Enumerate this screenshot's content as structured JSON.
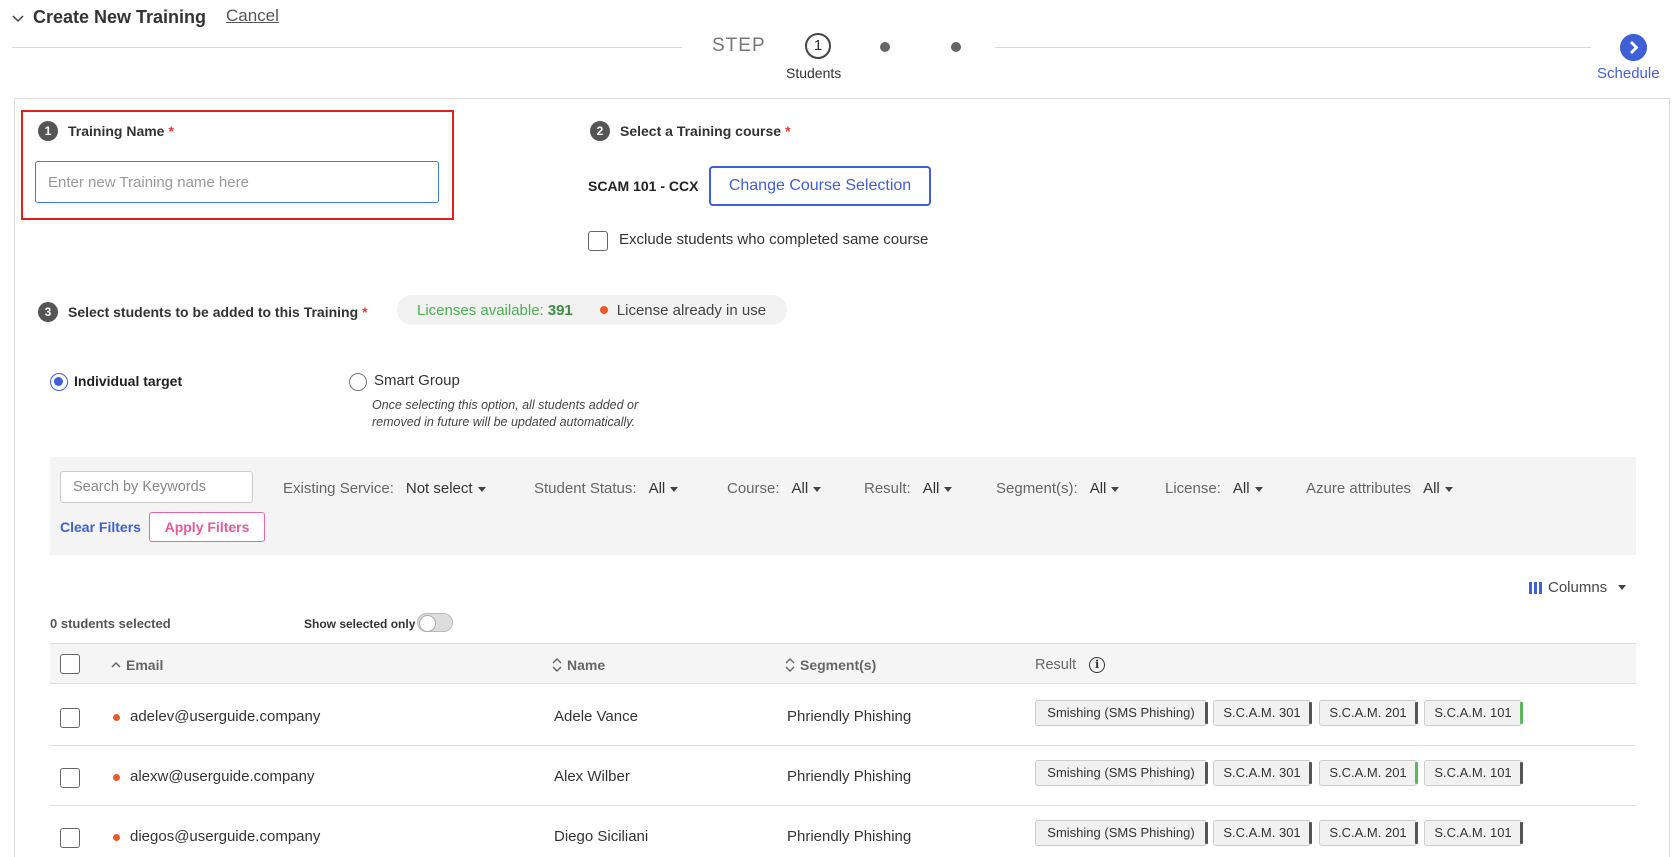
{
  "header": {
    "title": "Create New Training",
    "cancel_label": "Cancel",
    "step_label": "STEP",
    "step_number": "1",
    "step_name": "Students",
    "final_step_name": "Schedule"
  },
  "section1": {
    "number": "1",
    "title": "Training Name",
    "required_mark": "*",
    "input_placeholder": "Enter new Training name here",
    "input_value": ""
  },
  "section2": {
    "number": "2",
    "title": "Select a Training course",
    "required_mark": "*",
    "course_code": "SCAM 101 - CCX",
    "change_button": "Change Course Selection",
    "exclude_label": "Exclude students who completed same course"
  },
  "section3": {
    "number": "3",
    "title": "Select students to be added to this Training",
    "required_mark": "*",
    "licenses_label": "Licenses available:",
    "licenses_count": "391",
    "license_in_use": "License already in use"
  },
  "targeting": {
    "individual_label": "Individual target",
    "smart_label": "Smart Group",
    "smart_desc": "Once selecting this option, all students added or removed in future will be updated automatically.",
    "selected": "individual"
  },
  "filters": {
    "search_placeholder": "Search by Keywords",
    "items": [
      {
        "label": "Existing Service:",
        "value": "Not select"
      },
      {
        "label": "Student Status:",
        "value": "All"
      },
      {
        "label": "Course:",
        "value": "All"
      },
      {
        "label": "Result:",
        "value": "All"
      },
      {
        "label": "Segment(s):",
        "value": "All"
      },
      {
        "label": "License:",
        "value": "All"
      },
      {
        "label": "Azure attributes",
        "value": "All"
      }
    ],
    "clear_label": "Clear Filters",
    "apply_label": "Apply Filters"
  },
  "table": {
    "columns_button": "Columns",
    "selected_count": "0 students selected",
    "show_selected_only": "Show selected only",
    "headers": {
      "email": "Email",
      "name": "Name",
      "segments": "Segment(s)",
      "result": "Result"
    },
    "rows": [
      {
        "email": "adelev@userguide.company",
        "name": "Adele Vance",
        "segment": "Phriendly Phishing",
        "tags": [
          "Smishing (SMS Phishing)",
          "S.C.A.M. 301",
          "S.C.A.M. 201",
          "S.C.A.M. 101"
        ],
        "green_tag": 3
      },
      {
        "email": "alexw@userguide.company",
        "name": "Alex Wilber",
        "segment": "Phriendly Phishing",
        "tags": [
          "Smishing (SMS Phishing)",
          "S.C.A.M. 301",
          "S.C.A.M. 201",
          "S.C.A.M. 101"
        ],
        "green_tag": 2
      },
      {
        "email": "diegos@userguide.company",
        "name": "Diego Siciliani",
        "segment": "Phriendly Phishing",
        "tags": [
          "Smishing (SMS Phishing)",
          "S.C.A.M. 301",
          "S.C.A.M. 201",
          "S.C.A.M. 101"
        ],
        "green_tag": -1
      }
    ]
  },
  "colors": {
    "accent": "#3f5fd6",
    "required": "#e53935",
    "license_green": "#4caf50",
    "in_use_dot": "#ea5a2a",
    "highlight": "#e02020"
  }
}
